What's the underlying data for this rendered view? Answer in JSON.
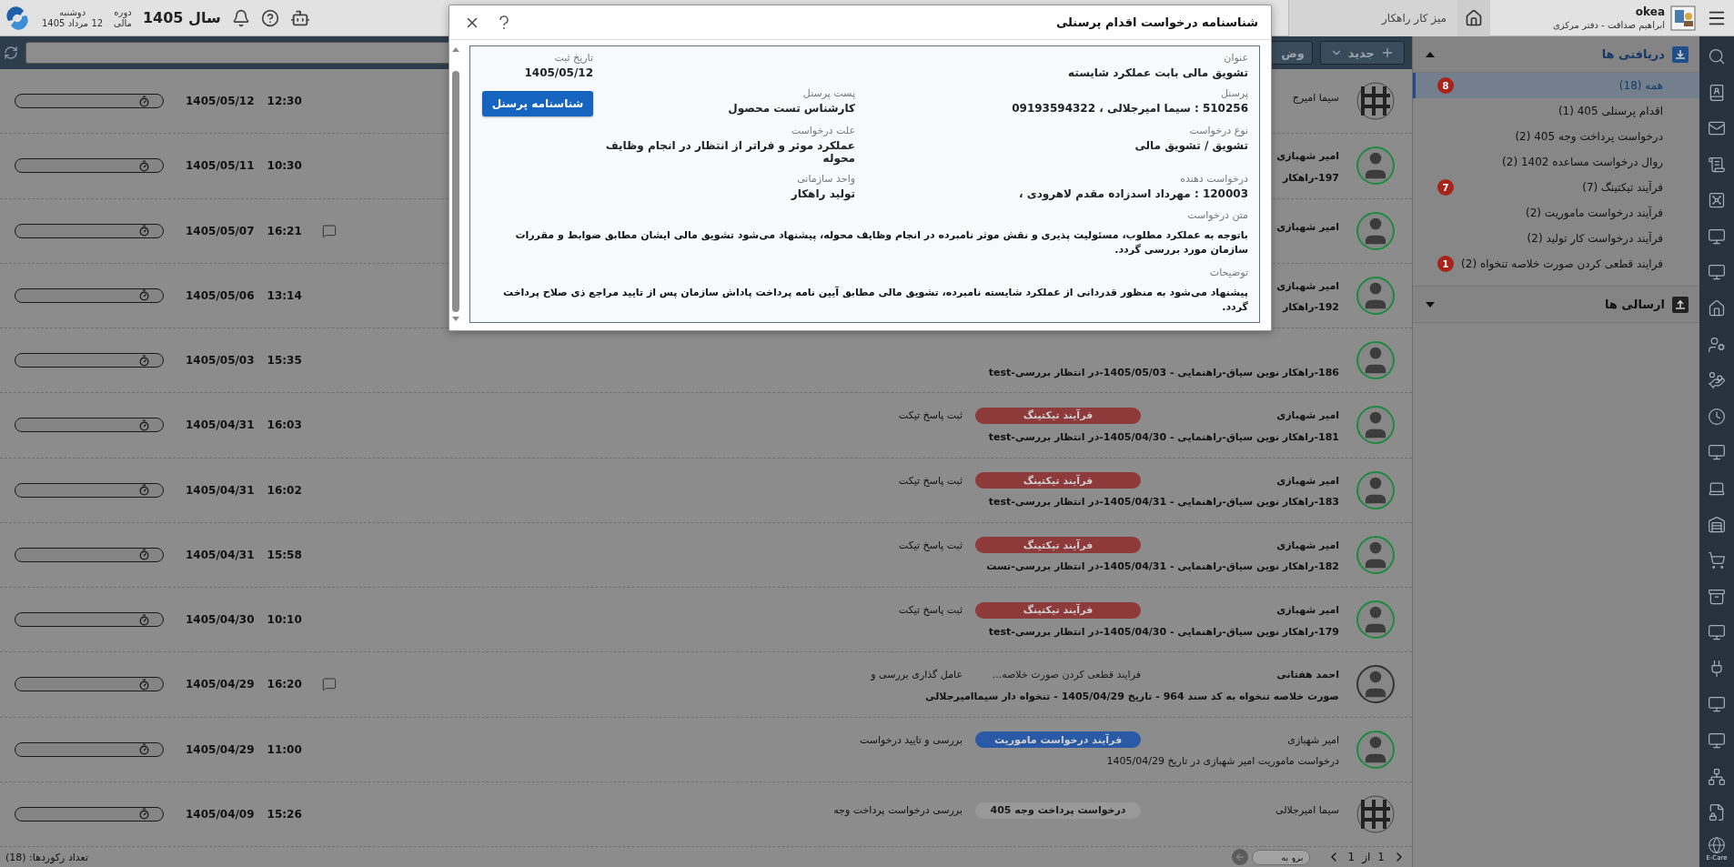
{
  "header": {
    "brand": "okea",
    "user": "ابراهیم صداقت - دفتر مرکزی",
    "tab": "میز کار راهکار",
    "year": "سال 1405",
    "period": "دوره مالی",
    "weekday": "دوشنبه",
    "date": "12 مرداد 1405"
  },
  "toolbar": {
    "new_button": "جدید",
    "status_button": "وض"
  },
  "sidebar": {
    "sections": [
      {
        "title": "دریافتی ها",
        "kind": "inbox",
        "expanded": true,
        "items": [
          {
            "label": "همه (18)",
            "selected": true,
            "badge": "8"
          },
          {
            "label": "اقدام پرسنلی 405 (1)",
            "selected": false
          },
          {
            "label": "درخواست پرداخت وجه 405 (2)",
            "selected": false
          },
          {
            "label": "روال درخواست مساعده 1402 (2)",
            "selected": false
          },
          {
            "label": "فرآیند تیکتینگ (7)",
            "selected": false,
            "badge": "7"
          },
          {
            "label": "فرآیند درخواست ماموریت (2)",
            "selected": false
          },
          {
            "label": "فرآیند درخواست کار تولید (2)",
            "selected": false
          },
          {
            "label": "فرایند قطعی کردن صورت خلاصه تنخواه (2)",
            "selected": false,
            "badge": "1"
          }
        ]
      },
      {
        "title": "ارسالی ها",
        "kind": "outbox",
        "expanded": false
      }
    ]
  },
  "rows": [
    {
      "name": "سیما امیرج",
      "unread": false,
      "avatar": {
        "kind": "pattern"
      },
      "time": "12:30",
      "date": "1405/05/12",
      "chat": false
    },
    {
      "name": "امیر شهبازی",
      "unread": true,
      "avatar": {
        "kind": "person",
        "color": "#1d8a3f"
      },
      "subject": "197-راهکار",
      "time": "10:30",
      "date": "1405/05/11",
      "chat": false
    },
    {
      "name": "امیر شهبازی",
      "unread": true,
      "avatar": {
        "kind": "person",
        "color": "#1d8a3f"
      },
      "time": "16:21",
      "date": "1405/05/07",
      "chat": true
    },
    {
      "name": "امیر شهبازی",
      "unread": true,
      "avatar": {
        "kind": "person",
        "color": "#1d8a3f"
      },
      "subject": "192-راهکار",
      "time": "13:14",
      "date": "1405/05/06",
      "chat": false
    },
    {
      "unread": true,
      "avatar": {
        "kind": "person",
        "color": "#1d8a3f"
      },
      "subject": "186-راهکار نوین سیاق-راهنمایی - 1405/05/03-در انتظار بررسی-test",
      "time": "15:35",
      "date": "1405/05/03",
      "chat": false
    },
    {
      "name": "امیر شهبازی",
      "unread": true,
      "avatar": {
        "kind": "person",
        "color": "#1d8a3f"
      },
      "tag": {
        "kind": "pill",
        "label": "فرآیند تیکتینگ",
        "color": "#8e3a3a"
      },
      "action": "ثبت پاسخ تیکت",
      "subject": "181-راهکار نوین سیاق-راهنمایی - 1405/04/30-در انتظار بررسی-test",
      "time": "16:03",
      "date": "1405/04/31",
      "chat": false
    },
    {
      "name": "امیر شهبازی",
      "unread": true,
      "avatar": {
        "kind": "person",
        "color": "#1d8a3f"
      },
      "tag": {
        "kind": "pill",
        "label": "فرآیند تیکتینگ",
        "color": "#8e3a3a"
      },
      "action": "ثبت پاسخ تیکت",
      "subject": "183-راهکار نوین سیاق-راهنمایی - 1405/04/31-در انتظار بررسی-test",
      "time": "16:02",
      "date": "1405/04/31",
      "chat": false
    },
    {
      "name": "امیر شهبازی",
      "unread": true,
      "avatar": {
        "kind": "person",
        "color": "#1d8a3f"
      },
      "tag": {
        "kind": "pill",
        "label": "فرآیند تیکتینگ",
        "color": "#8e3a3a"
      },
      "action": "ثبت پاسخ تیکت",
      "subject": "182-راهکار نوین سیاق-راهنمایی - 1405/04/31-در انتظار بررسی-تست",
      "time": "15:58",
      "date": "1405/04/31",
      "chat": false
    },
    {
      "name": "امیر شهبازی",
      "unread": true,
      "avatar": {
        "kind": "person",
        "color": "#1d8a3f"
      },
      "tag": {
        "kind": "pill",
        "label": "فرآیند تیکتینگ",
        "color": "#8e3a3a"
      },
      "action": "ثبت پاسخ تیکت",
      "subject": "179-راهکار نوین سیاق-راهنمایی - 1405/04/30-در انتظار بررسی-test",
      "time": "10:10",
      "date": "1405/04/30",
      "chat": false
    },
    {
      "name": "احمد هفتانی",
      "unread": true,
      "avatar": {
        "kind": "person",
        "color": "#333333"
      },
      "tag": {
        "kind": "text",
        "label": "فرایند قطعی کردن صورت خلاصه..."
      },
      "action": "عامل گذاری بررسی و",
      "subject": "صورت خلاصه تنخواه به کد سند 964 - تاریخ 1405/04/29 - تنخواه دار سیماامیرجلالی",
      "time": "16:20",
      "date": "1405/04/29",
      "chat": true
    },
    {
      "name": "امیر شهبازی",
      "unread": false,
      "avatar": {
        "kind": "person",
        "color": "#1d8a3f"
      },
      "tag": {
        "kind": "pill",
        "label": "فرآیند درخواست ماموریت",
        "color": "#2a5aa6"
      },
      "action": "بررسی و تایید درخواست",
      "subject": "درخواست ماموریت امیر شهبازی در تاریخ 1405/04/29",
      "time": "11:00",
      "date": "1405/04/29",
      "chat": false
    },
    {
      "name": "سیما امیرجلالی",
      "unread": false,
      "avatar": {
        "kind": "pattern"
      },
      "tag": {
        "kind": "pill",
        "label": "درخواست پرداخت وجه 405",
        "color": "#999999"
      },
      "action": "بررسی درخواست پرداخت وجه",
      "time": "15:26",
      "date": "1405/04/09",
      "chat": false
    }
  ],
  "footer": {
    "record_count": "تعداد رکوردها: (18)",
    "page": "1",
    "of": "از",
    "pages": "1",
    "goto_placeholder": "برو به"
  },
  "icon_bar": {
    "globe_label": "E-Care"
  },
  "dialog": {
    "title": "شناسنامه درخواست اقدام پرسنلی",
    "grid": [
      {
        "primary": {
          "label": "عنوان",
          "value": "تشویق مالی بابت عملکرد شایسته"
        },
        "tertiary": {
          "label": "تاریخ ثبت",
          "value": "1405/05/12"
        }
      },
      {
        "primary": {
          "label": "پرسنل",
          "value": "510256 : سیما امیرجلالی ، 09193594322"
        },
        "secondary": {
          "label": "پست پرسنل",
          "value": "کارشناس تست محصول"
        },
        "button": "شناسنامه پرسنل"
      },
      {
        "primary": {
          "label": "نوع درخواست",
          "value": "تشویق / تشویق مالی"
        },
        "secondary": {
          "label": "علت درخواست",
          "value": "عملکرد موثر و فراتر از انتظار در انجام وظایف محوله"
        }
      },
      {
        "primary": {
          "label": "درخواست دهنده",
          "value": "120003 : مهرداد اسدزاده مقدم لاهرودی ،"
        },
        "secondary": {
          "label": "واحد سازمانی",
          "value": "تولید راهکار"
        }
      }
    ],
    "paragraphs": [
      {
        "label": "متن درخواست",
        "text": "باتوجه به عملکرد مطلوب، مسئولیت پذیری و نقش موثر نامبرده در انجام وظایف محوله، پیشنهاد می‌شود تشویق مالی ایشان مطابق ضوابط و مقررات سازمان مورد بررسی گردد."
      },
      {
        "label": "توضیحات",
        "text": "پیشنهاد می‌شود به منظور قدردانی از عملکرد شایسته نامبرده، تشویق مالی مطابق آیین نامه پرداخت پاداش سازمان پس از تایید مراجع ذی صلاح پرداخت گردد."
      }
    ]
  }
}
